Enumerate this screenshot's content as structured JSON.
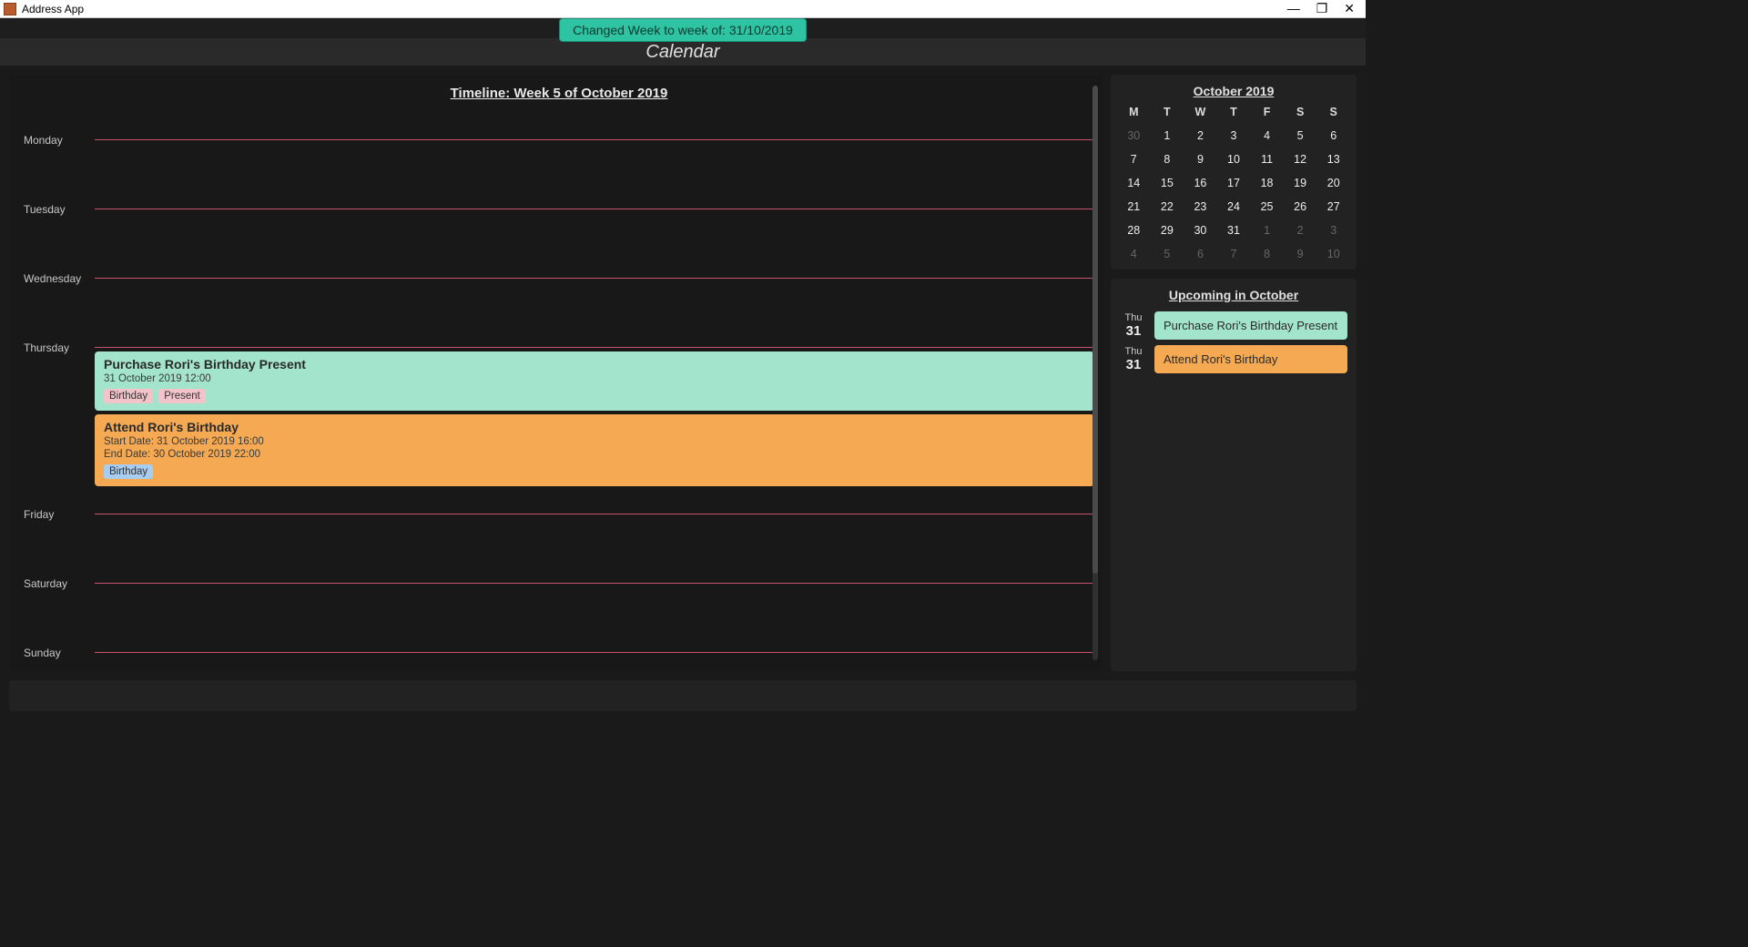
{
  "window": {
    "title": "Address App"
  },
  "notification": "Changed Week to week of: 31/10/2019",
  "app_title": "Calendar",
  "timeline": {
    "title": "Timeline: Week 5 of October 2019",
    "days": {
      "mon": "Monday",
      "tue": "Tuesday",
      "wed": "Wednesday",
      "thu": "Thursday",
      "fri": "Friday",
      "sat": "Saturday",
      "sun": "Sunday"
    },
    "thursday_events": [
      {
        "title": "Purchase Rori's Birthday Present",
        "line1": "31 October 2019 12:00",
        "line2": "",
        "tags": [
          {
            "label": "Birthday",
            "cls": "tag-pink"
          },
          {
            "label": "Present",
            "cls": "tag-pink"
          }
        ],
        "color": "ev-green"
      },
      {
        "title": "Attend Rori's Birthday",
        "line1": "Start Date: 31 October 2019 16:00",
        "line2": "End Date: 30 October 2019 22:00",
        "tags": [
          {
            "label": "Birthday",
            "cls": "tag-blue"
          }
        ],
        "color": "ev-orange"
      }
    ]
  },
  "minicalendar": {
    "title": "October 2019",
    "heads": [
      "M",
      "T",
      "W",
      "T",
      "F",
      "S",
      "S"
    ],
    "cells": [
      {
        "n": "30",
        "muted": true
      },
      {
        "n": "1"
      },
      {
        "n": "2"
      },
      {
        "n": "3"
      },
      {
        "n": "4"
      },
      {
        "n": "5"
      },
      {
        "n": "6"
      },
      {
        "n": "7"
      },
      {
        "n": "8"
      },
      {
        "n": "9"
      },
      {
        "n": "10"
      },
      {
        "n": "11"
      },
      {
        "n": "12"
      },
      {
        "n": "13"
      },
      {
        "n": "14"
      },
      {
        "n": "15"
      },
      {
        "n": "16"
      },
      {
        "n": "17"
      },
      {
        "n": "18"
      },
      {
        "n": "19"
      },
      {
        "n": "20"
      },
      {
        "n": "21"
      },
      {
        "n": "22"
      },
      {
        "n": "23"
      },
      {
        "n": "24"
      },
      {
        "n": "25"
      },
      {
        "n": "26"
      },
      {
        "n": "27"
      },
      {
        "n": "28"
      },
      {
        "n": "29"
      },
      {
        "n": "30",
        "badge": "green"
      },
      {
        "n": "31",
        "badge": "blue"
      },
      {
        "n": "1",
        "muted": true
      },
      {
        "n": "2",
        "muted": true
      },
      {
        "n": "3",
        "muted": true
      },
      {
        "n": "4",
        "muted": true
      },
      {
        "n": "5",
        "muted": true
      },
      {
        "n": "6",
        "muted": true
      },
      {
        "n": "7",
        "muted": true
      },
      {
        "n": "8",
        "muted": true
      },
      {
        "n": "9",
        "muted": true
      },
      {
        "n": "10",
        "muted": true
      }
    ]
  },
  "upcoming": {
    "title": "Upcoming in October",
    "items": [
      {
        "dow": "Thu",
        "day": "31",
        "label": "Purchase Rori's Birthday Present",
        "color": "ev-green"
      },
      {
        "dow": "Thu",
        "day": "31",
        "label": "Attend Rori's Birthday",
        "color": "ev-orange"
      }
    ]
  },
  "colors": {
    "accent_green": "#2ec4a3",
    "event_green": "#a3e4cd",
    "event_orange": "#f5a952",
    "divider": "#c9516b"
  }
}
